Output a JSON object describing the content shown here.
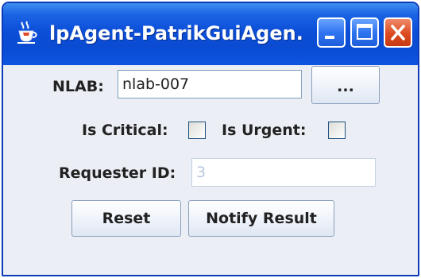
{
  "window": {
    "title": "lpAgent-PatrikGuiAgen...",
    "icon": "java-coffee-cup-icon",
    "controls": {
      "minimize_icon": "minimize-icon",
      "maximize_icon": "maximize-icon",
      "close_icon": "close-icon"
    }
  },
  "form": {
    "nlab": {
      "label": "NLAB:",
      "value": "nlab-007",
      "browse_label": "..."
    },
    "is_critical": {
      "label": "Is Critical:",
      "checked": false
    },
    "is_urgent": {
      "label": "Is Urgent:",
      "checked": false
    },
    "requester_id": {
      "label": "Requester ID:",
      "value": "3"
    }
  },
  "buttons": {
    "reset": "Reset",
    "notify": "Notify Result"
  },
  "colors": {
    "titlebar": "#0c4fd8",
    "window_border": "#0b3bb8",
    "content_bg": "#ebeef4",
    "close_button": "#dc4a20",
    "field_border": "#7f9db9"
  }
}
